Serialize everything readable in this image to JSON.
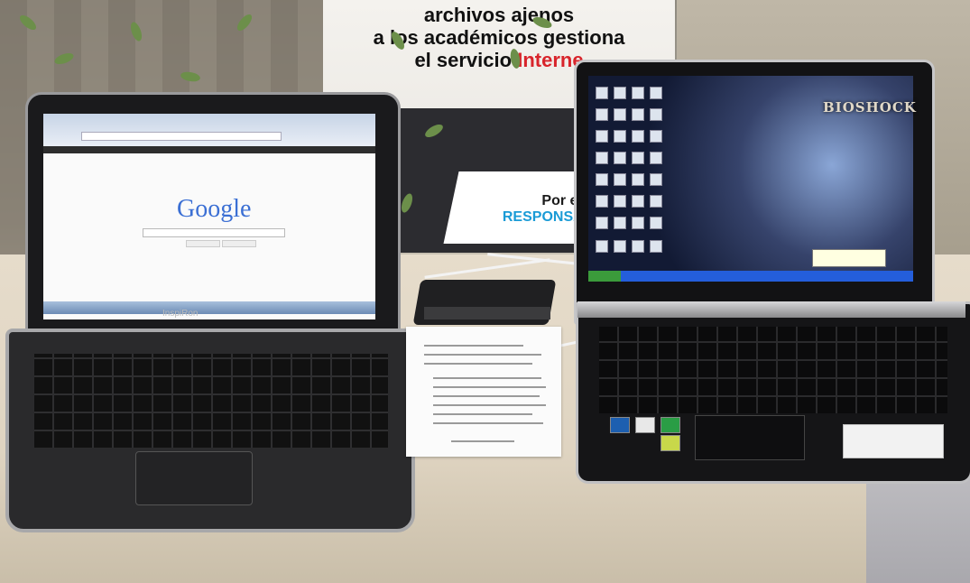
{
  "banner": {
    "line1": "archivos ajenos",
    "line2": "a los académicos gestiona",
    "line3_a": "el servicio",
    "line3_b": "Interne",
    "line4": "Por el us",
    "line5": "RESPONSABL"
  },
  "left_laptop": {
    "google_logo": "Google",
    "brand": "InspiRon"
  },
  "right_laptop": {
    "wallpaper_title": "BIOSHOCK"
  },
  "colors": {
    "banner_red": "#d8242b",
    "banner_blue": "#1a9bd6",
    "xp_taskbar": "#245edb"
  }
}
